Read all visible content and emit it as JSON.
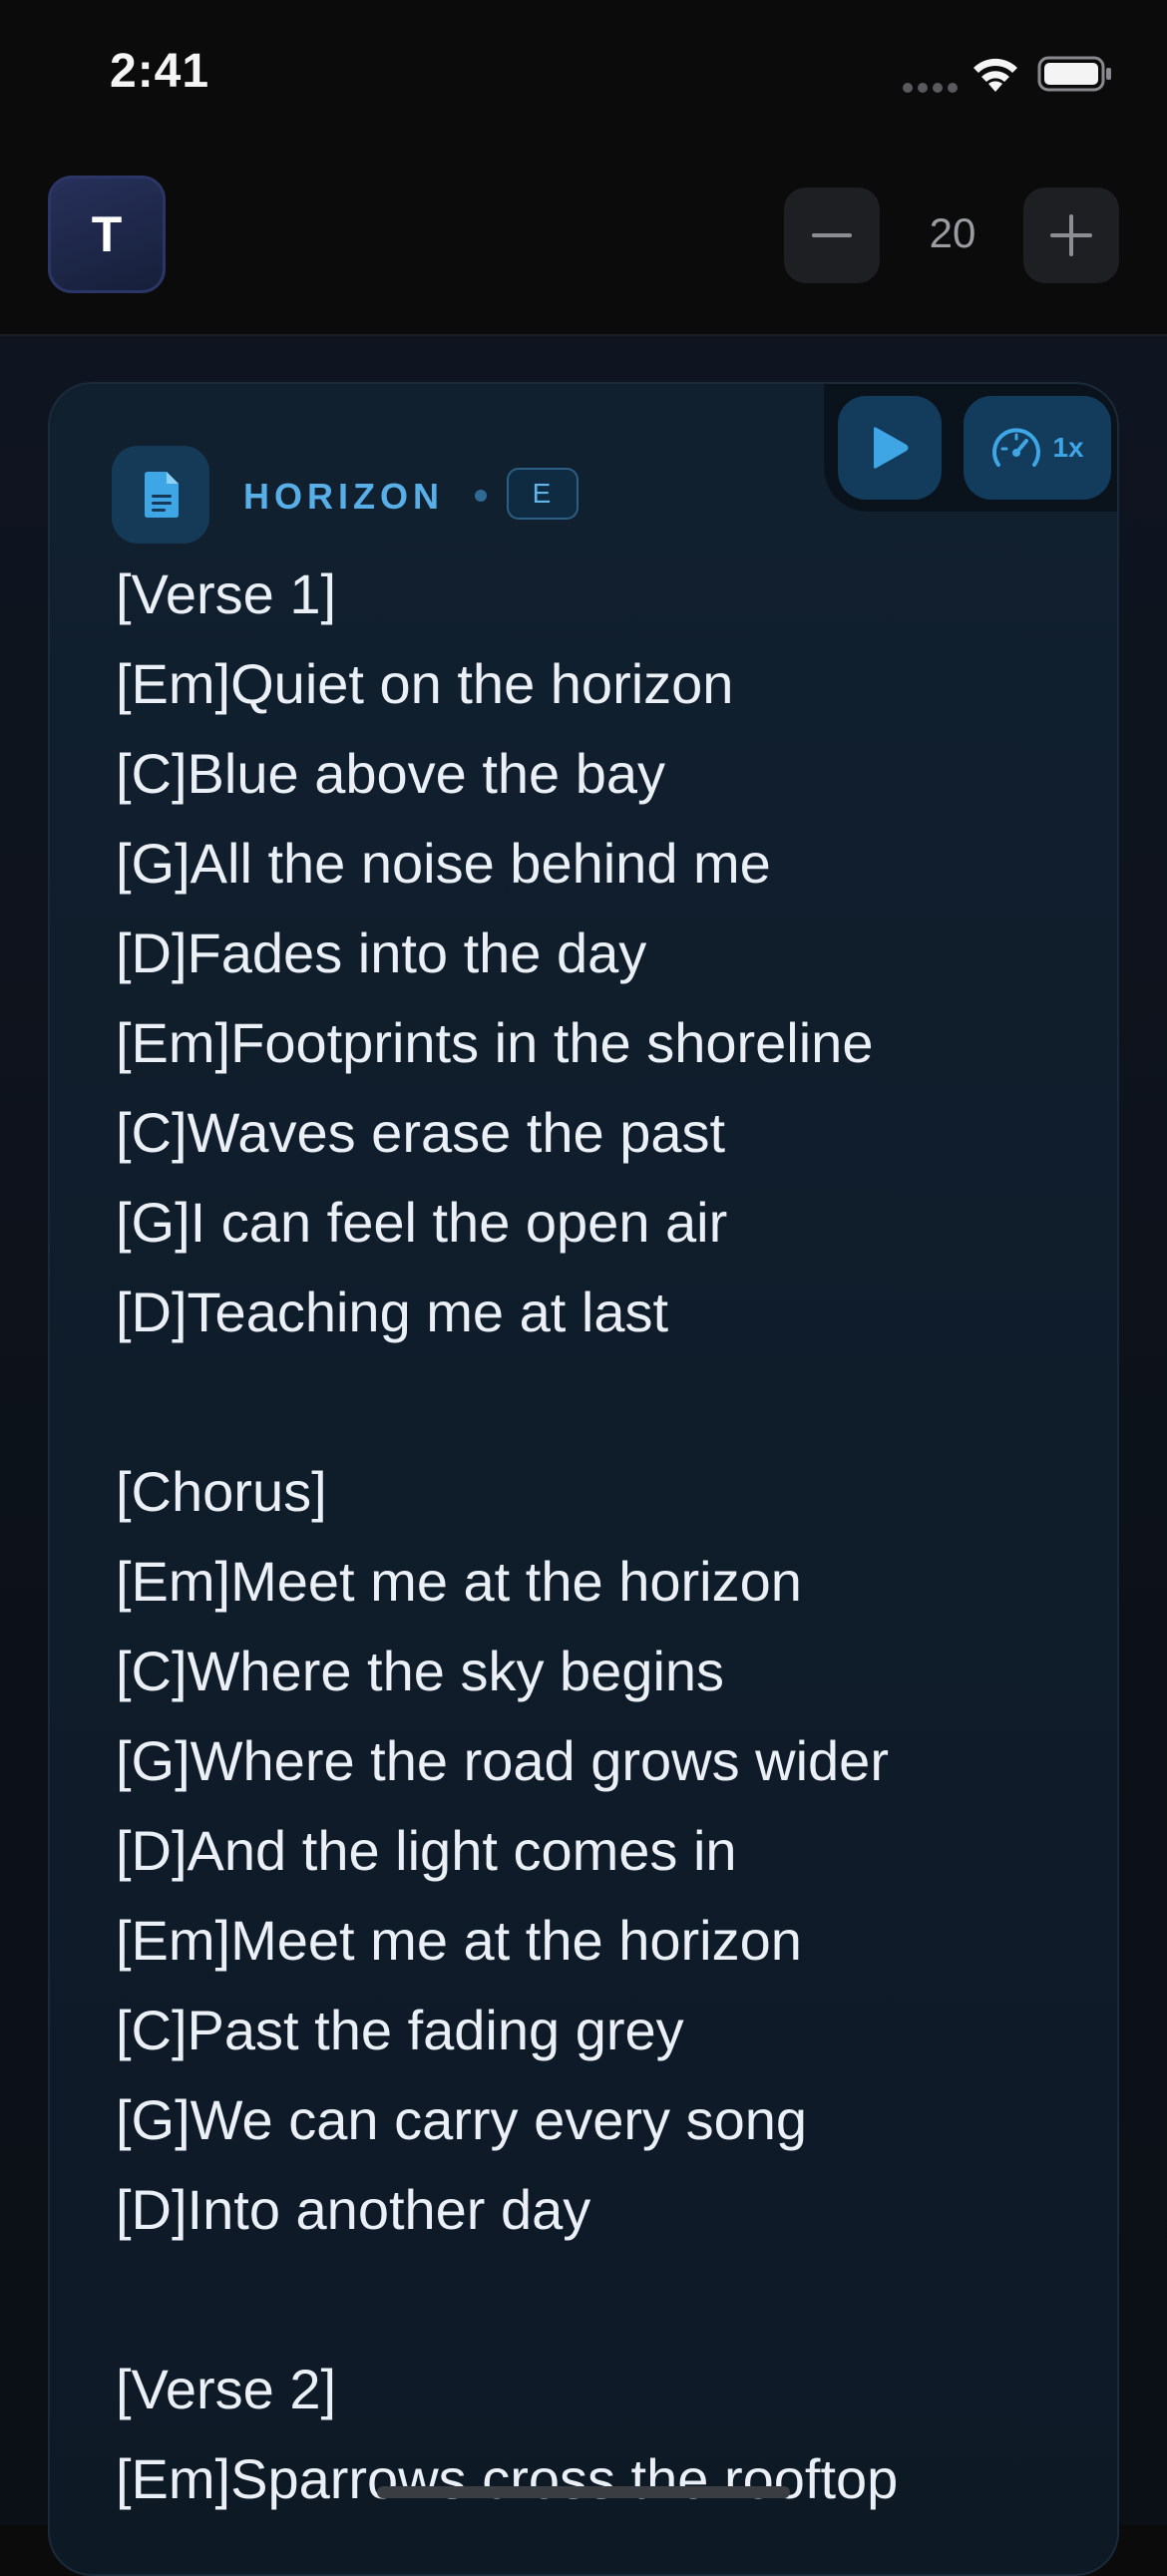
{
  "status_bar": {
    "time": "2:41",
    "icons": [
      "signal-dots-icon",
      "wifi-icon",
      "battery-icon"
    ]
  },
  "header": {
    "avatar_initial": "T",
    "font_size": "20",
    "decrease_icon": "minus-icon",
    "increase_icon": "plus-icon"
  },
  "song": {
    "title": "HORIZON",
    "key": "E",
    "icon": "document-icon"
  },
  "playback": {
    "play_icon": "play-icon",
    "speed_icon": "speedometer-icon",
    "speed": "1x"
  },
  "lyrics": [
    "[Verse 1]",
    "[Em]Quiet on the horizon",
    "[C]Blue above the bay",
    "[G]All the noise behind me",
    "[D]Fades into the day",
    "[Em]Footprints in the shoreline",
    "[C]Waves erase the past",
    "[G]I can feel the open air",
    "[D]Teaching me at last",
    "",
    "[Chorus]",
    "[Em]Meet me at the horizon",
    "[C]Where the sky begins",
    "[G]Where the road grows wider",
    "[D]And the light comes in",
    "[Em]Meet me at the horizon",
    "[C]Past the fading grey",
    "[G]We can carry every song",
    "[D]Into another day",
    "",
    "[Verse 2]",
    "[Em]Sparrows cross the rooftop"
  ],
  "colors": {
    "accent": "#58aee6",
    "card_bg": "#11202f",
    "page_bg": "#0b0b0c",
    "avatar_border": "#2b3566"
  }
}
